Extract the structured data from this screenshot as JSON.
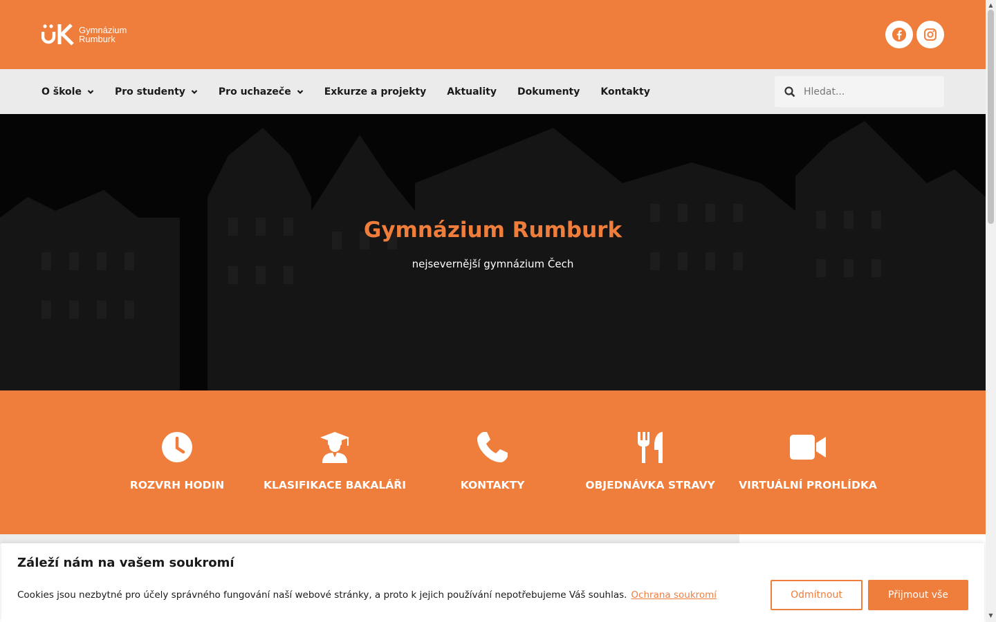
{
  "brand": {
    "logo_line1": "Gymnázium",
    "logo_line2": "Rumburk",
    "accent": "#ef7d3c",
    "nav_bg": "#ebebeb"
  },
  "social": [
    {
      "name": "facebook",
      "icon": "facebook-icon"
    },
    {
      "name": "instagram",
      "icon": "instagram-icon"
    }
  ],
  "nav": {
    "items": [
      {
        "label": "O škole",
        "has_dropdown": true
      },
      {
        "label": "Pro studenty",
        "has_dropdown": true
      },
      {
        "label": "Pro uchazeče",
        "has_dropdown": true
      },
      {
        "label": "Exkurze a projekty",
        "has_dropdown": false
      },
      {
        "label": "Aktuality",
        "has_dropdown": false
      },
      {
        "label": "Dokumenty",
        "has_dropdown": false
      },
      {
        "label": "Kontakty",
        "has_dropdown": false
      }
    ],
    "search_placeholder": "Hledat..."
  },
  "hero": {
    "title": "Gymnázium Rumburk",
    "subtitle": "nejsevernější gymnázium Čech"
  },
  "quick_links": [
    {
      "label": "ROZVRH HODIN",
      "icon": "clock-icon"
    },
    {
      "label": "KLASIFIKACE BAKALÁŘI",
      "icon": "graduate-icon"
    },
    {
      "label": "KONTAKTY",
      "icon": "phone-icon"
    },
    {
      "label": "OBJEDNÁVKA STRAVY",
      "icon": "utensils-icon"
    },
    {
      "label": "VIRTUÁLNÍ PROHLÍDKA",
      "icon": "video-icon"
    }
  ],
  "cookie": {
    "title": "Záleží nám na vašem soukromí",
    "text": "Cookies jsou nezbytné pro účely správného fungování naší webové stránky, a proto k jejich používání nepotřebujeme Váš souhlas.",
    "link": "Ochrana soukromí",
    "decline": "Odmítnout",
    "accept": "Přijmout vše"
  }
}
